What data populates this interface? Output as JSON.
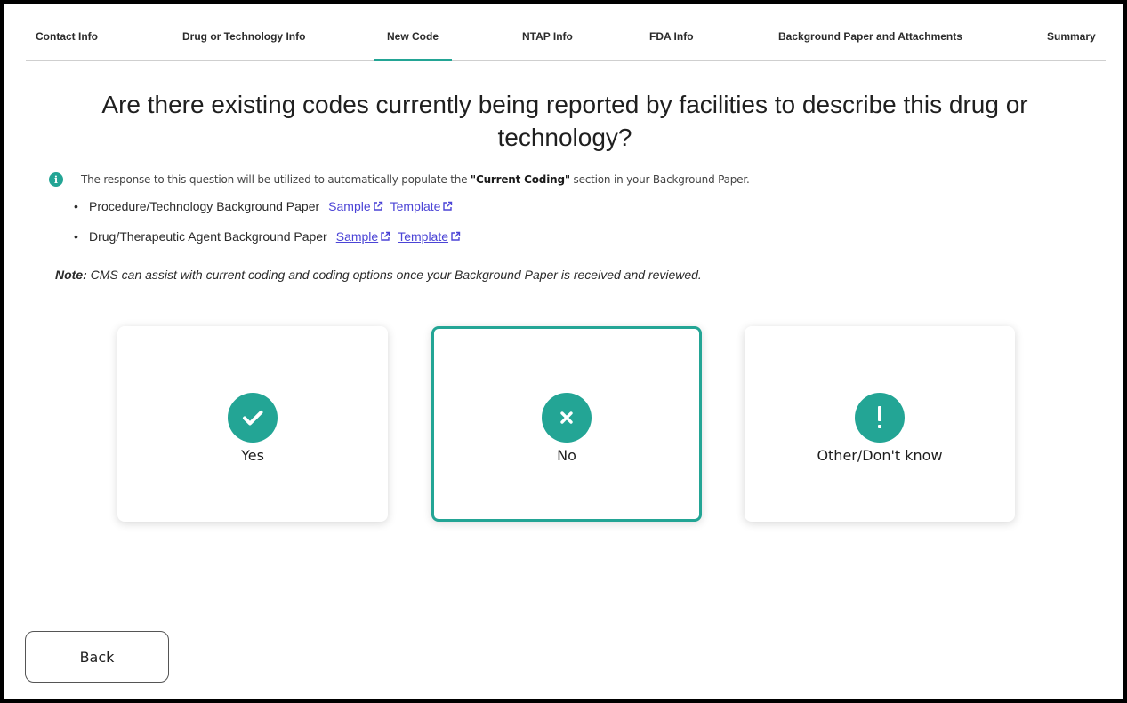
{
  "tabs": [
    {
      "label": "Contact Info"
    },
    {
      "label": "Drug or Technology Info"
    },
    {
      "label": "New Code"
    },
    {
      "label": "NTAP Info"
    },
    {
      "label": "FDA Info"
    },
    {
      "label": "Background Paper and Attachments"
    },
    {
      "label": "Summary"
    }
  ],
  "active_tab": "New Code",
  "question": "Are there existing codes currently being reported by facilities to describe this drug or technology?",
  "info": {
    "before": "The response to this question will be utilized to automatically populate the ",
    "highlight": "\"Current Coding\"",
    "after": " section in your Background Paper."
  },
  "bullets": [
    {
      "label": "Procedure/Technology Background Paper",
      "sample": "Sample",
      "template": "Template"
    },
    {
      "label": "Drug/Therapeutic Agent Background Paper",
      "sample": "Sample",
      "template": "Template"
    }
  ],
  "note": {
    "prefix": "Note:",
    "text": " CMS can assist with current coding and coding options once your Background Paper is received and reviewed."
  },
  "options": [
    {
      "label": "Yes",
      "icon": "check-icon",
      "selected": false
    },
    {
      "label": "No",
      "icon": "x-icon",
      "selected": true
    },
    {
      "label": "Other/Don't know",
      "icon": "exclamation-icon",
      "selected": false
    }
  ],
  "back_label": "Back",
  "colors": {
    "accent": "#23a595",
    "link": "#4b44d6"
  }
}
